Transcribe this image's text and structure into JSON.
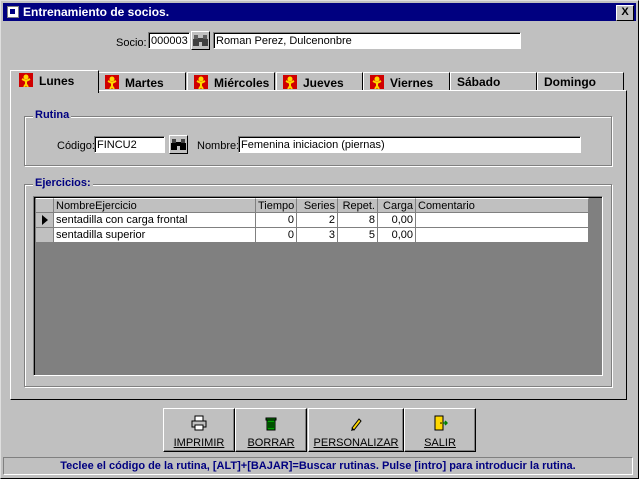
{
  "window": {
    "title": "Entrenamiento de socios.",
    "close_label": "X"
  },
  "socio": {
    "label": "Socio:",
    "code": "000003",
    "name": "Roman Perez, Dulcenonbre"
  },
  "tabs": [
    {
      "label": "Lunes",
      "active": true,
      "has_icon": true
    },
    {
      "label": "Martes",
      "has_icon": true
    },
    {
      "label": "Miércoles",
      "has_icon": true
    },
    {
      "label": "Jueves",
      "has_icon": true
    },
    {
      "label": "Viernes",
      "has_icon": true
    },
    {
      "label": "Sábado",
      "has_icon": false
    },
    {
      "label": "Domingo",
      "has_icon": false
    }
  ],
  "rutina": {
    "group_title": "Rutina",
    "codigo_label": "Código:",
    "codigo_value": "FINCU2",
    "nombre_label": "Nombre:",
    "nombre_value": "Femenina iniciacion (piernas)"
  },
  "ejercicios": {
    "group_title": "Ejercicios:",
    "columns": [
      "NombreEjercicio",
      "Tiempo",
      "Series",
      "Repet.",
      "Carga",
      "Comentario"
    ],
    "rows": [
      {
        "nombre": "sentadilla con carga frontal",
        "tiempo": "0",
        "series": "2",
        "repet": "8",
        "carga": "0,00",
        "comentario": ""
      },
      {
        "nombre": "sentadilla superior",
        "tiempo": "0",
        "series": "3",
        "repet": "5",
        "carga": "0,00",
        "comentario": ""
      }
    ]
  },
  "buttons": {
    "imprimir": "IMPRIMIR",
    "borrar": "BORRAR",
    "personalizar": "PERSONALIZAR",
    "salir": "SALIR"
  },
  "status": "Teclee el código de la rutina, [ALT]+[BAJAR]=Buscar rutinas. Pulse [intro] para introducir la rutina.",
  "colors": {
    "title_bar": "#000080",
    "face": "#c0c0c0",
    "group_title": "#000080",
    "tab_icon": "#d00000"
  }
}
